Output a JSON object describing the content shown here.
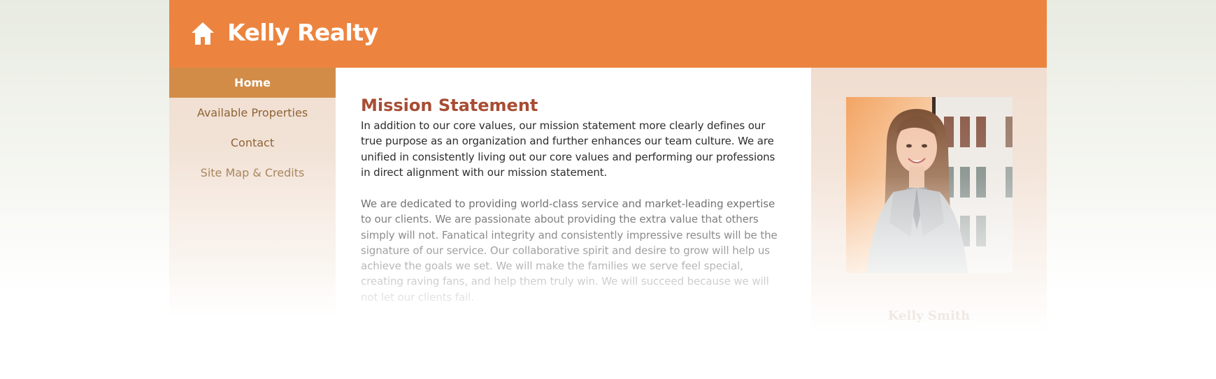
{
  "header": {
    "logo_icon": "house-icon",
    "title": "Kelly Realty",
    "background_color": "#ec843f"
  },
  "nav": {
    "items": [
      {
        "label": "Home",
        "active": true
      },
      {
        "label": "Available Properties",
        "active": false
      },
      {
        "label": "Contact",
        "active": false
      },
      {
        "label": "Site Map & Credits",
        "active": false
      }
    ],
    "active_color": "#d28c48"
  },
  "main": {
    "title": "Mission Statement",
    "paragraphs": [
      "In addition to our core values, our mission statement more clearly defines our true purpose as an organization and further enhances our team culture. We are unified in consistently living out our core values and performing our professions in direct alignment with our mission statement.",
      "We are dedicated to providing world-class service and market-leading expertise to our clients. We are passionate about providing the extra value that others simply will not. Fanatical integrity and consistently impressive results will be the signature of our service. Our collaborative spirit and desire to grow will help us achieve the goals we set. We will make the families we serve feel special, creating raving fans, and help them truly win. We will succeed because we will not let our clients fail."
    ],
    "title_color": "#a74d33"
  },
  "profile": {
    "photo": "agent-portrait-photo",
    "name": "Kelly Smith"
  }
}
